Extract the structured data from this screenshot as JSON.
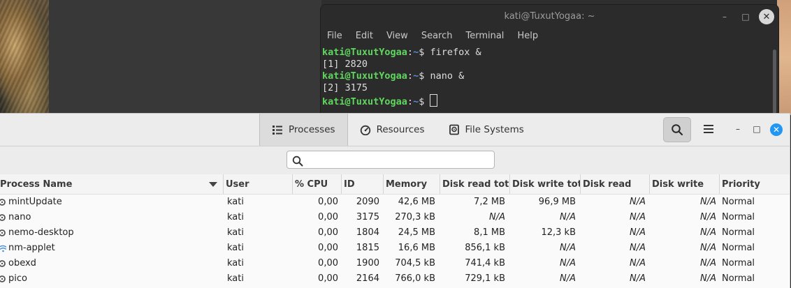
{
  "terminal": {
    "title": "kati@TuxutYogaa: ~",
    "menu": [
      "File",
      "Edit",
      "View",
      "Search",
      "Terminal",
      "Help"
    ],
    "prompt_user": "kati@TuxutYogaa",
    "prompt_sep": ":",
    "prompt_dir": "~",
    "prompt_sym": "$",
    "lines": [
      {
        "type": "cmd",
        "text": " firefox &"
      },
      {
        "type": "out",
        "text": "[1] 2820"
      },
      {
        "type": "cmd",
        "text": " nano &"
      },
      {
        "type": "out",
        "text": "[2] 3175"
      },
      {
        "type": "cmd",
        "text": " "
      }
    ]
  },
  "sysmon": {
    "tabs": [
      {
        "label": "Processes",
        "icon": "list-icon"
      },
      {
        "label": "Resources",
        "icon": "gauge-icon"
      },
      {
        "label": "File Systems",
        "icon": "disk-icon"
      }
    ],
    "search_placeholder": "",
    "columns": [
      "Process Name",
      "User",
      "% CPU",
      "ID",
      "Memory",
      "Disk read total",
      "Disk write tota",
      "Disk read",
      "Disk write",
      "Priority"
    ],
    "rows": [
      {
        "name": "mintUpdate",
        "icon": "gear-icon",
        "user": "kati",
        "cpu": "0,00",
        "id": "2090",
        "memory": "42,6 MB",
        "dread_total": "7,2 MB",
        "dwrite_total": "96,9 MB",
        "dread": "N/A",
        "dwrite": "N/A",
        "priority": "Normal"
      },
      {
        "name": "nano",
        "icon": "gear-icon",
        "user": "kati",
        "cpu": "0,00",
        "id": "3175",
        "memory": "270,3 kB",
        "dread_total": "N/A",
        "dwrite_total": "N/A",
        "dread": "N/A",
        "dwrite": "N/A",
        "priority": "Normal"
      },
      {
        "name": "nemo-desktop",
        "icon": "gear-icon",
        "user": "kati",
        "cpu": "0,00",
        "id": "1804",
        "memory": "24,5 MB",
        "dread_total": "8,1 MB",
        "dwrite_total": "12,3 kB",
        "dread": "N/A",
        "dwrite": "N/A",
        "priority": "Normal"
      },
      {
        "name": "nm-applet",
        "icon": "wifi-icon",
        "user": "kati",
        "cpu": "0,00",
        "id": "1815",
        "memory": "16,6 MB",
        "dread_total": "856,1 kB",
        "dwrite_total": "N/A",
        "dread": "N/A",
        "dwrite": "N/A",
        "priority": "Normal"
      },
      {
        "name": "obexd",
        "icon": "gear-icon",
        "user": "kati",
        "cpu": "0,00",
        "id": "1900",
        "memory": "704,5 kB",
        "dread_total": "741,4 kB",
        "dwrite_total": "N/A",
        "dread": "N/A",
        "dwrite": "N/A",
        "priority": "Normal"
      },
      {
        "name": "pico",
        "icon": "gear-icon",
        "user": "kati",
        "cpu": "0,00",
        "id": "2164",
        "memory": "766,0 kB",
        "dread_total": "729,1 kB",
        "dwrite_total": "N/A",
        "dread": "N/A",
        "dwrite": "N/A",
        "priority": "Normal"
      }
    ]
  }
}
